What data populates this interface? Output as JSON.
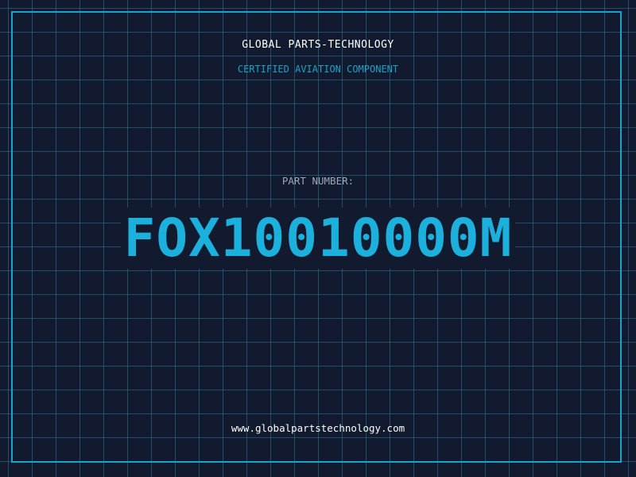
{
  "brand": {
    "name": "GLOBAL PARTS-TECHNOLOGY",
    "tagline": "CERTIFIED AVIATION COMPONENT"
  },
  "part": {
    "label": "PART NUMBER:",
    "number": "FOX10010000M"
  },
  "footer": {
    "url": "www.globalpartstechnology.com"
  },
  "colors": {
    "background": "#111a2e",
    "grid": "#34788f",
    "accent": "#1ba3c9",
    "text": "#ffffff",
    "muted": "#9aa8bc"
  }
}
